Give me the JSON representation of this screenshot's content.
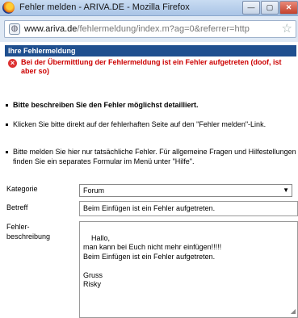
{
  "window": {
    "title": "Fehler melden - ARIVA.DE - Mozilla Firefox",
    "min_label": "—",
    "max_label": "▢",
    "close_label": "✕"
  },
  "address": {
    "url_prefix": "www.ariva.de",
    "url_rest": "/fehlermeldung/index.m?ag=0&referrer=http"
  },
  "page": {
    "section_title": "Ihre Fehlermeldung",
    "error_message": "Bei der Übermittlung der Fehlermeldung ist ein Fehler aufgetreten (doof, ist aber so)",
    "bullets": [
      "Bitte beschreiben Sie den Fehler möglichst detailliert.",
      "Klicken Sie bitte direkt auf der fehlerhaften Seite auf den \"Fehler melden\"-Link.",
      "Bitte melden Sie hier nur tatsächliche Fehler. Für allgemeine Fragen und Hilfestellungen finden Sie ein separates Formular im Menü unter \"Hilfe\"."
    ]
  },
  "form": {
    "category_label": "Kategorie",
    "category_value": "Forum",
    "subject_label": "Betreff",
    "subject_value": "Beim Einfügen ist ein Fehler aufgetreten.",
    "description_label": "Fehler-\nbeschreibung",
    "description_value": "Hallo,\nman kann bei Euch nicht mehr einfügen!!!!!\nBeim Einfügen ist ein Fehler aufgetreten.\n\nGruss\nRisky"
  }
}
